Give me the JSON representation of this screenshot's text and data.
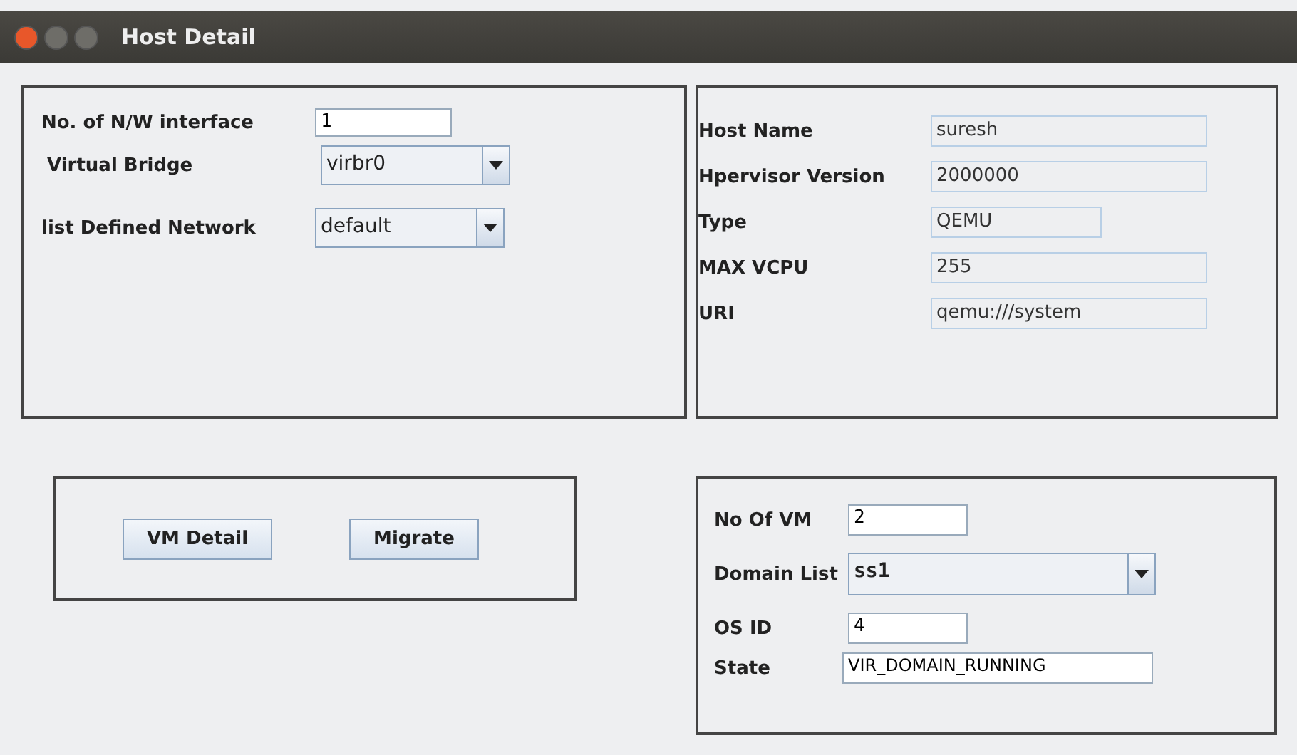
{
  "window": {
    "title": "Host Detail"
  },
  "network_panel": {
    "rows": [
      {
        "label": "No. of N/W interface",
        "kind": "text",
        "value": "1"
      },
      {
        "label": "Virtual Bridge",
        "kind": "combo",
        "value": "virbr0"
      },
      {
        "label": "list Defined Network",
        "kind": "combo",
        "value": "default"
      }
    ]
  },
  "host_panel": {
    "rows": [
      {
        "label": "Host Name",
        "value": "suresh"
      },
      {
        "label": "Hpervisor Version",
        "value": "2000000"
      },
      {
        "label": "Type",
        "value": "QEMU"
      },
      {
        "label": "MAX VCPU",
        "value": "255"
      },
      {
        "label": "URI",
        "value": "qemu:///system"
      }
    ]
  },
  "buttons": [
    "VM Detail",
    "Migrate"
  ],
  "vm_panel": {
    "rows": [
      {
        "label": "No Of VM",
        "kind": "text",
        "value": "2"
      },
      {
        "label": "Domain List",
        "kind": "combo",
        "value": "ss1"
      },
      {
        "label": "OS ID",
        "kind": "text",
        "value": "4"
      },
      {
        "label": "State",
        "kind": "text",
        "value": "VIR_DOMAIN_RUNNING"
      }
    ]
  }
}
